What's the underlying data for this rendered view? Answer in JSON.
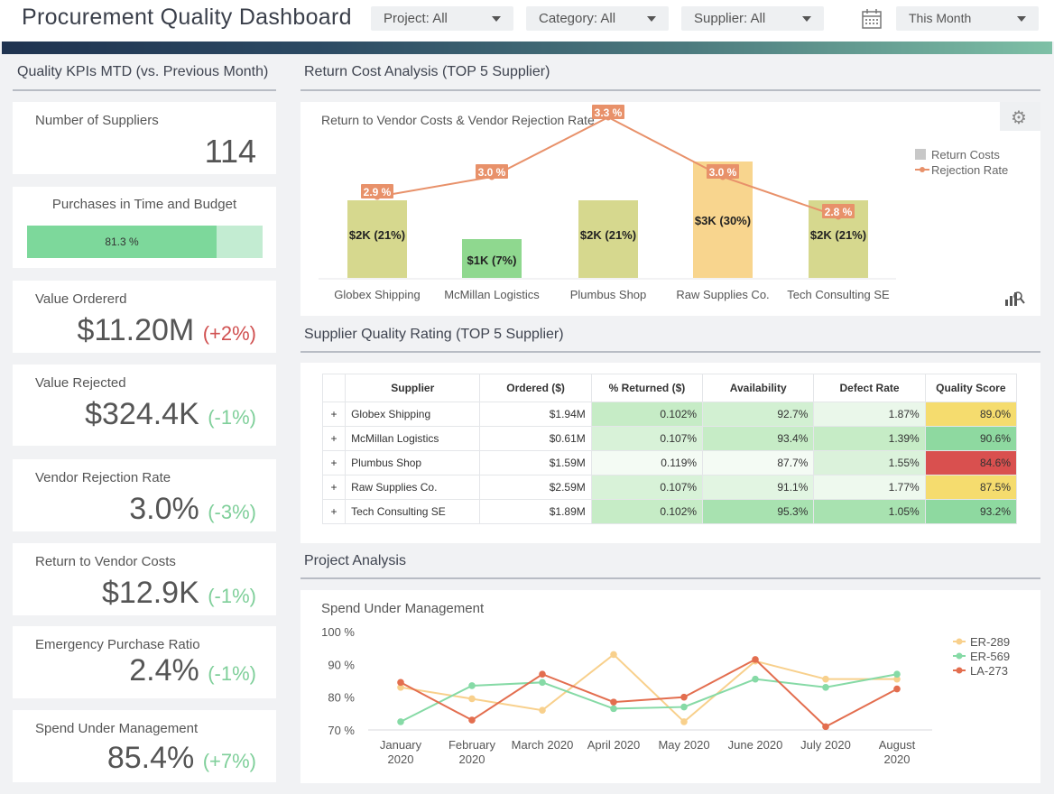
{
  "header": {
    "title": "Procurement Quality Dashboard",
    "filters": [
      {
        "label": "Project: All"
      },
      {
        "label": "Category: All"
      },
      {
        "label": "Supplier: All"
      }
    ],
    "date_filter": "This Month"
  },
  "kpi_section": {
    "title": "Quality KPIs MTD (vs. Previous Month)",
    "cards": [
      {
        "label": "Number of Suppliers",
        "value": "114",
        "change": ""
      },
      {
        "label": "Value Ordererd",
        "value": "$11.20M",
        "change": "(+2%)"
      },
      {
        "label": "Value Rejected",
        "value": "$324.4K",
        "change": "(-1%)"
      },
      {
        "label": "Vendor Rejection Rate",
        "value": "3.0%",
        "change": "(-3%)"
      },
      {
        "label": "Return to Vendor Costs",
        "value": "$12.9K",
        "change": "(-1%)"
      },
      {
        "label": "Emergency Purchase Ratio",
        "value": "2.4%",
        "change": "(-1%)"
      },
      {
        "label": "Spend Under Management",
        "value": "85.4%",
        "change": "(+7%)"
      }
    ],
    "progress": {
      "label": "Purchases in Time and Budget",
      "value_text": "81.3 %",
      "fraction": 0.813
    }
  },
  "return_cost": {
    "section_title": "Return Cost Analysis (TOP 5 Supplier)",
    "chart_title": "Return to Vendor Costs & Vendor Rejection Rate",
    "legend": [
      "Return Costs",
      "Rejection Rate"
    ]
  },
  "chart_data": [
    {
      "type": "bar",
      "title": "Return to Vendor Costs & Vendor Rejection Rate",
      "categories": [
        "Globex Shipping",
        "McMillan Logistics",
        "Plumbus Shop",
        "Raw Supplies Co.",
        "Tech Consulting SE"
      ],
      "series": [
        {
          "name": "Return Costs",
          "values": [
            2,
            1,
            2,
            3,
            2
          ],
          "labels": [
            "$2K (21%)",
            "$1K (7%)",
            "$2K (21%)",
            "$3K (30%)",
            "$2K (21%)"
          ],
          "colors": [
            "#d6d88e",
            "#8fd88f",
            "#d6d88e",
            "#f8d58e",
            "#d6d88e"
          ]
        },
        {
          "name": "Rejection Rate",
          "values": [
            2.9,
            3.0,
            3.3,
            3.0,
            2.8
          ],
          "labels": [
            "2.9 %",
            "3.0 %",
            "3.3 %",
            "3.0 %",
            "2.8 %"
          ],
          "color": "#e8916a"
        }
      ]
    },
    {
      "type": "line",
      "title": "Spend Under Management",
      "categories": [
        [
          "January",
          "2020"
        ],
        [
          "February",
          "2020"
        ],
        [
          "March 2020"
        ],
        [
          "April 2020"
        ],
        [
          "May 2020"
        ],
        [
          "June 2020"
        ],
        [
          "July 2020"
        ],
        [
          "August",
          "2020"
        ]
      ],
      "yticks": [
        "100 %",
        "90 %",
        "80 %",
        "70 %"
      ],
      "ylim": [
        70,
        100
      ],
      "series": [
        {
          "name": "ER-289",
          "color": "#f8d08c",
          "values": [
            83,
            79.5,
            76,
            93,
            72.5,
            91,
            85.5,
            85.5
          ]
        },
        {
          "name": "ER-569",
          "color": "#86daa6",
          "values": [
            72.5,
            83.5,
            84.5,
            76.5,
            77,
            85.5,
            83,
            87
          ]
        },
        {
          "name": "LA-273",
          "color": "#e36e4f",
          "values": [
            84.5,
            73,
            87,
            78.5,
            80,
            91.5,
            71,
            82.5
          ]
        }
      ]
    }
  ],
  "quality_rating": {
    "section_title": "Supplier Quality Rating (TOP 5 Supplier)",
    "columns": [
      "Supplier",
      "Ordered ($)",
      "% Returned ($)",
      "Availability",
      "Defect Rate",
      "Quality Score"
    ],
    "rows": [
      {
        "expand": "+",
        "supplier": "Globex Shipping",
        "ordered": "$1.94M",
        "returned": "0.102%",
        "availability": "92.7%",
        "defect": "1.87%",
        "score": "89.0%",
        "returned_bg": "#c6ecc6",
        "avail_bg": "#d2f0d2",
        "defect_bg": "#eaf7ea",
        "score_bg": "#f5dc6e"
      },
      {
        "expand": "+",
        "supplier": "McMillan Logistics",
        "ordered": "$0.61M",
        "returned": "0.107%",
        "availability": "93.4%",
        "defect": "1.39%",
        "score": "90.6%",
        "returned_bg": "#d8f2d8",
        "avail_bg": "#c6ecc6",
        "defect_bg": "#c6ecc6",
        "score_bg": "#8ed9a0"
      },
      {
        "expand": "+",
        "supplier": "Plumbus Shop",
        "ordered": "$1.59M",
        "returned": "0.119%",
        "availability": "87.7%",
        "defect": "1.55%",
        "score": "84.6%",
        "returned_bg": "#f4fbf4",
        "avail_bg": "#f4fbf4",
        "defect_bg": "#dbf2db",
        "score_bg": "#d9504f"
      },
      {
        "expand": "+",
        "supplier": "Raw Supplies Co.",
        "ordered": "$2.59M",
        "returned": "0.107%",
        "availability": "91.1%",
        "defect": "1.77%",
        "score": "87.5%",
        "returned_bg": "#d8f2d8",
        "avail_bg": "#e2f5e2",
        "defect_bg": "#eef9ee",
        "score_bg": "#f5dc6e"
      },
      {
        "expand": "+",
        "supplier": "Tech Consulting SE",
        "ordered": "$1.89M",
        "returned": "0.102%",
        "availability": "95.3%",
        "defect": "1.05%",
        "score": "93.2%",
        "returned_bg": "#c6ecc6",
        "avail_bg": "#a8e2b0",
        "defect_bg": "#a8e2b0",
        "score_bg": "#8ed9a0"
      }
    ]
  },
  "project_analysis": {
    "section_title": "Project Analysis",
    "chart_title": "Spend Under Management"
  }
}
